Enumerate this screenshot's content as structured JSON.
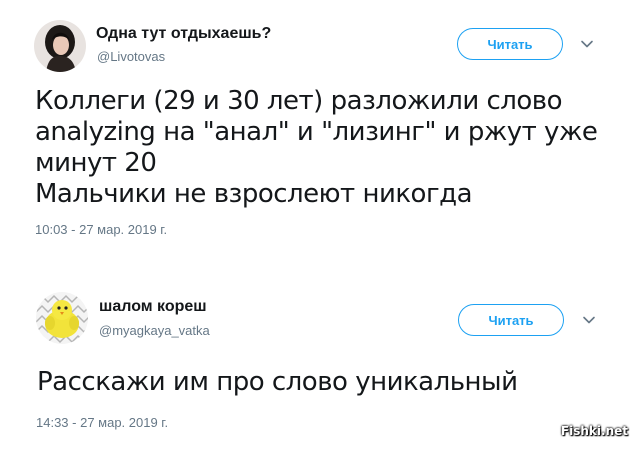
{
  "tweets": [
    {
      "display_name": "Одна тут отдыхаешь?",
      "handle": "@Livotovas",
      "read_label": "Читать",
      "text": "Коллеги (29 и 30 лет) разложили слово\nanalyzing на \"анал\" и \"лизинг\" и ржут уже\nминут 20\nМальчики не взрослеют никогда",
      "timestamp": "10:03 - 27 мар. 2019 г.",
      "avatar_icon": "user-photo-avatar"
    },
    {
      "display_name": "шалом кореш",
      "handle": "@myagkaya_vatka",
      "read_label": "Читать",
      "text": "Расскажи им про слово уникальный",
      "timestamp": "14:33 - 27 мар. 2019 г.",
      "avatar_icon": "yellow-bird-avatar"
    }
  ],
  "watermark": "Fishki.net",
  "colors": {
    "accent": "#1da1f2",
    "text": "#14171a",
    "muted": "#657786"
  }
}
